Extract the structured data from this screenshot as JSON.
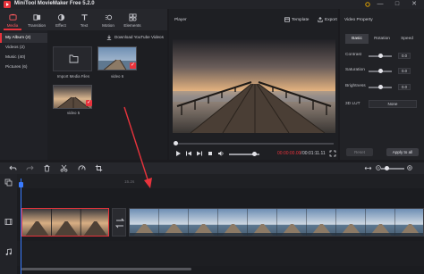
{
  "window": {
    "title": "MiniTool MovieMaker Free 5.2.0",
    "controls": [
      "—",
      "□",
      "✕"
    ]
  },
  "media_toolbar": {
    "tabs": [
      {
        "label": "Media",
        "icon": "media-icon",
        "active": true
      },
      {
        "label": "Transition",
        "icon": "transition-icon",
        "active": false
      },
      {
        "label": "Effect",
        "icon": "effect-icon",
        "active": false
      },
      {
        "label": "Text",
        "icon": "text-icon",
        "active": false
      },
      {
        "label": "Motion",
        "icon": "motion-icon",
        "active": false
      },
      {
        "label": "Elements",
        "icon": "elements-icon",
        "active": false
      }
    ]
  },
  "sidebar": {
    "items": [
      {
        "label": "My Album (2)",
        "active": true
      },
      {
        "label": "Videos (2)",
        "active": false
      },
      {
        "label": "Music (40)",
        "active": false
      },
      {
        "label": "Pictures (6)",
        "active": false
      }
    ]
  },
  "media": {
    "youtube_button": "Download YouTube Videos",
    "import_label": "Import Media Files",
    "items": [
      {
        "label": "video 6",
        "checked": true
      },
      {
        "label": "video 5",
        "checked": true
      }
    ]
  },
  "player": {
    "title": "Player",
    "template_label": "Template",
    "export_label": "Export",
    "time_current": "00:00:00.00",
    "time_separator": "/",
    "time_total": "00:01:11.11",
    "volume": 0.85
  },
  "property": {
    "title": "Video Property",
    "tabs": [
      {
        "label": "Basic",
        "active": true
      },
      {
        "label": "Rotation",
        "active": false
      },
      {
        "label": "Speed",
        "active": false
      }
    ],
    "rows": [
      {
        "label": "Contrast",
        "value": "0.0",
        "level": 0.5
      },
      {
        "label": "Saturation",
        "value": "0.0",
        "level": 0.5
      },
      {
        "label": "Brightness",
        "value": "0.0",
        "level": 0.5
      }
    ],
    "lut_label": "3D LUT",
    "lut_value": "None",
    "reset_label": "Reset",
    "apply_label": "Apply to all"
  },
  "timeline": {
    "ruler_label": "15.2s",
    "tools": [
      "undo-icon",
      "redo-icon",
      "delete-icon",
      "split-icon",
      "speed-icon",
      "crop-icon"
    ],
    "zoom_level": 0.25
  },
  "colors": {
    "accent": "#e8333c",
    "playhead": "#3a7bff",
    "background": "#1b1b1f"
  }
}
